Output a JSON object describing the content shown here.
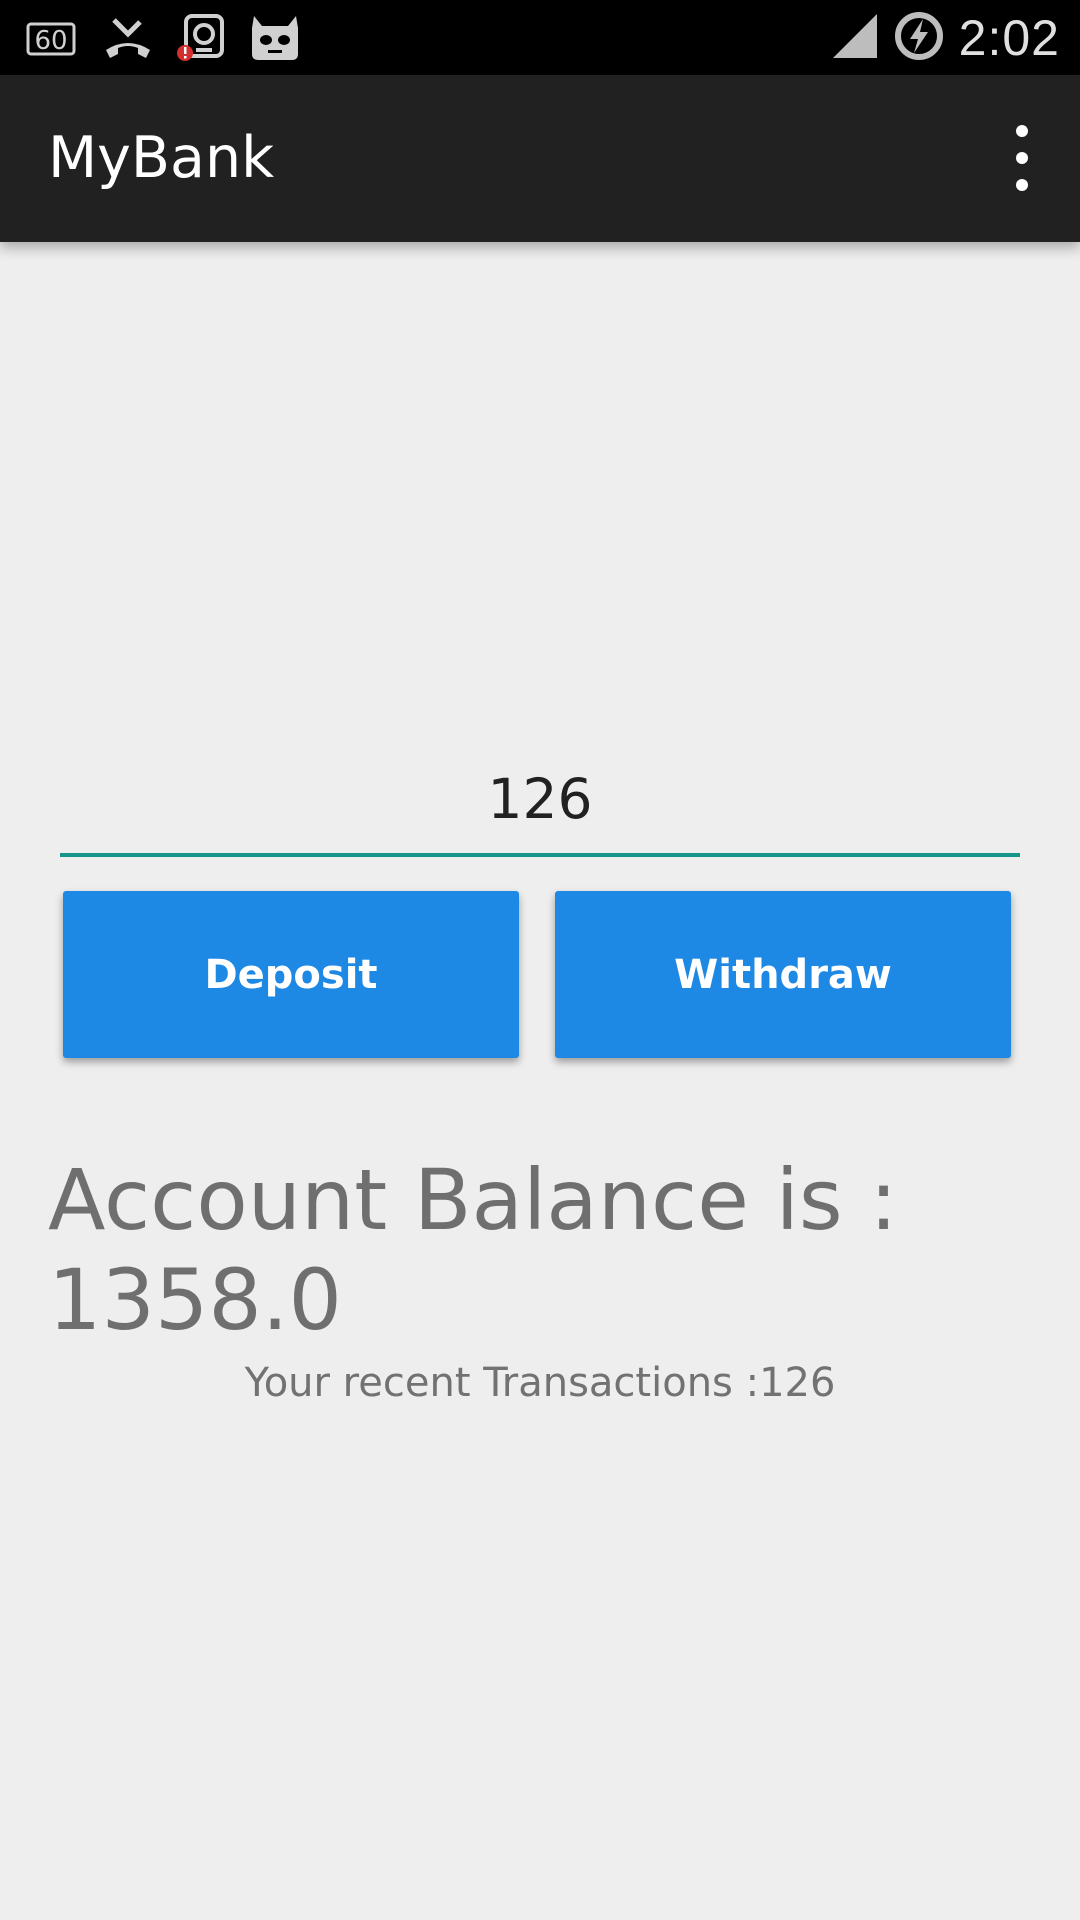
{
  "status_bar": {
    "time": "2:02",
    "icons": [
      "sixty-fps-icon",
      "missed-call-icon",
      "app-alert-icon",
      "cyanogenmod-icon",
      "cell-signal-icon",
      "battery-charging-icon"
    ],
    "sixty_label": "60"
  },
  "app_bar": {
    "title": "MyBank",
    "menu_icon": "more-vertical-icon"
  },
  "form": {
    "amount_value": "126",
    "accent_color": "#159688"
  },
  "buttons": {
    "deposit_label": "Deposit",
    "withdraw_label": "Withdraw",
    "color": "#1e88e5"
  },
  "account": {
    "balance_text": "Account Balance is : 1358.0",
    "recent_text": "Your recent Transactions :126"
  }
}
